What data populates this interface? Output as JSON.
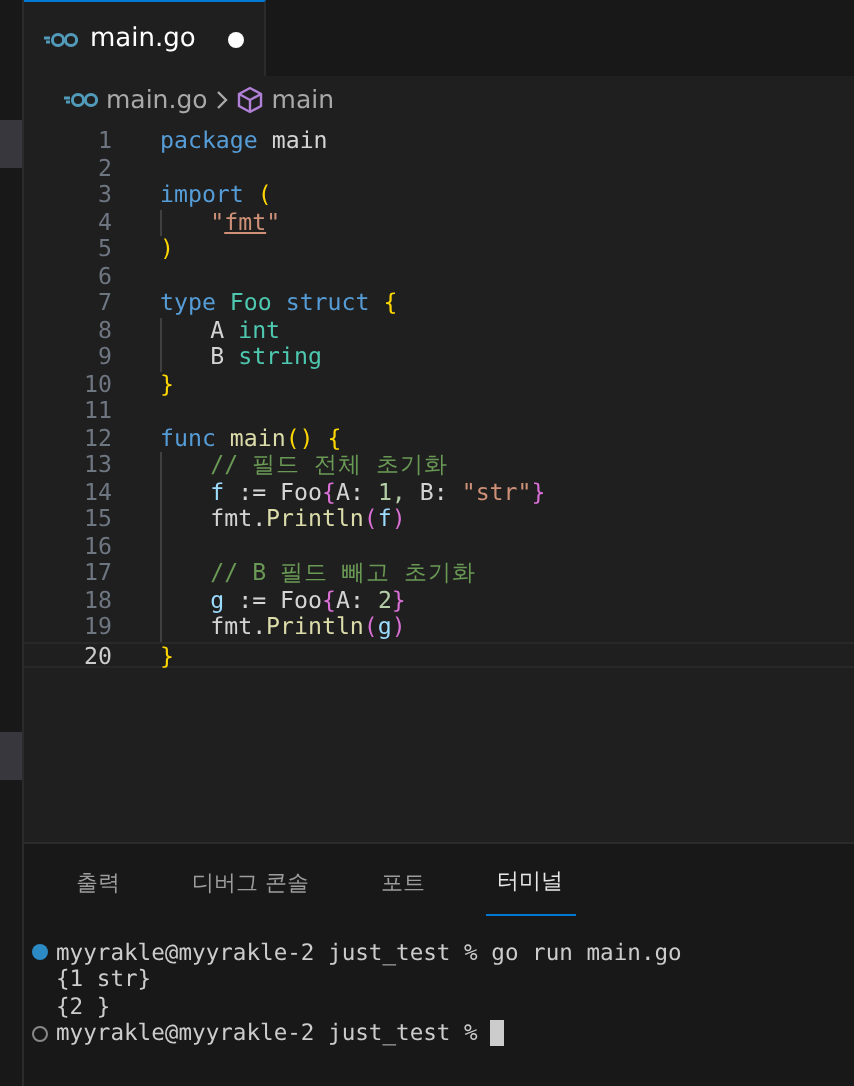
{
  "tab": {
    "label": "main.go",
    "modified": true,
    "selected": true
  },
  "breadcrumb": [
    "main.go",
    "main"
  ],
  "code": [
    {
      "number": "1",
      "current": false,
      "indented": false,
      "tokens": [
        {
          "text": "package",
          "kind": "kw"
        },
        {
          "text": "main",
          "kind": "plain"
        }
      ]
    },
    {
      "number": "2",
      "current": false,
      "indented": false
    },
    {
      "number": "3",
      "current": false,
      "indented": false,
      "tokens": [
        {
          "text": "import",
          "kind": "kw"
        },
        {
          "text": "(",
          "kind": "bracket1"
        }
      ]
    },
    {
      "number": "4",
      "current": false,
      "indented": true,
      "tokens": [
        {
          "text": "\"",
          "kind": "str"
        },
        {
          "text": "fmt",
          "kind": "strlink",
          "join": true
        },
        {
          "text": "\"",
          "kind": "str",
          "join": true
        }
      ]
    },
    {
      "number": "5",
      "current": false,
      "indented": false,
      "tokens": [
        {
          "text": ")",
          "kind": "bracket1"
        }
      ]
    },
    {
      "number": "6",
      "current": false,
      "indented": false
    },
    {
      "number": "7",
      "current": false,
      "indented": false,
      "tokens": [
        {
          "text": "type",
          "kind": "kw"
        },
        {
          "text": "Foo",
          "kind": "type"
        },
        {
          "text": "struct",
          "kind": "kw"
        },
        {
          "text": "{",
          "kind": "bracket1"
        }
      ]
    },
    {
      "number": "8",
      "current": false,
      "indented": true,
      "tokens": [
        {
          "text": "A",
          "kind": "plain"
        },
        {
          "text": "int",
          "kind": "type"
        }
      ]
    },
    {
      "number": "9",
      "current": false,
      "indented": true,
      "tokens": [
        {
          "text": "B",
          "kind": "plain"
        },
        {
          "text": "string",
          "kind": "type"
        }
      ]
    },
    {
      "number": "10",
      "current": false,
      "indented": false,
      "tokens": [
        {
          "text": "}",
          "kind": "bracket1"
        }
      ]
    },
    {
      "number": "11",
      "current": false,
      "indented": false
    },
    {
      "number": "12",
      "current": false,
      "indented": false,
      "tokens": [
        {
          "text": "func",
          "kind": "kw"
        },
        {
          "text": "main",
          "kind": "func"
        },
        {
          "text": "()",
          "kind": "bracket1",
          "join": true
        },
        {
          "text": "{",
          "kind": "bracket1"
        }
      ]
    },
    {
      "number": "13",
      "current": false,
      "indented": true,
      "tokens": [
        {
          "text": "// 필드 전체 초기화",
          "kind": "comment"
        }
      ]
    },
    {
      "number": "14",
      "current": false,
      "indented": true,
      "tokens": [
        {
          "text": "f",
          "kind": "var"
        },
        {
          "text": ":=",
          "kind": "plain"
        },
        {
          "text": "Foo",
          "kind": "plain"
        },
        {
          "text": "{",
          "kind": "bracket2",
          "join": true
        },
        {
          "text": "A:",
          "kind": "plain",
          "join": true
        },
        {
          "text": "1,",
          "kind": "num"
        },
        {
          "text": "B:",
          "kind": "plain"
        },
        {
          "text": "\"str\"",
          "kind": "str"
        },
        {
          "text": "}",
          "kind": "bracket2",
          "join": true
        }
      ]
    },
    {
      "number": "15",
      "current": false,
      "indented": true,
      "tokens": [
        {
          "text": "fmt.",
          "kind": "plain"
        },
        {
          "text": "Println",
          "kind": "func",
          "join": true
        },
        {
          "text": "(",
          "kind": "bracket2",
          "join": true
        },
        {
          "text": "f",
          "kind": "var",
          "join": true
        },
        {
          "text": ")",
          "kind": "bracket2",
          "join": true
        }
      ]
    },
    {
      "number": "16",
      "current": false,
      "indented": true
    },
    {
      "number": "17",
      "current": false,
      "indented": true,
      "tokens": [
        {
          "text": "// B 필드 빼고 초기화",
          "kind": "comment"
        }
      ]
    },
    {
      "number": "18",
      "current": false,
      "indented": true,
      "tokens": [
        {
          "text": "g",
          "kind": "var"
        },
        {
          "text": ":=",
          "kind": "plain"
        },
        {
          "text": "Foo",
          "kind": "plain"
        },
        {
          "text": "{",
          "kind": "bracket2",
          "join": true
        },
        {
          "text": "A:",
          "kind": "plain",
          "join": true
        },
        {
          "text": "2",
          "kind": "num"
        },
        {
          "text": "}",
          "kind": "bracket2",
          "join": true
        }
      ]
    },
    {
      "number": "19",
      "current": false,
      "indented": true,
      "tokens": [
        {
          "text": "fmt.",
          "kind": "plain"
        },
        {
          "text": "Println",
          "kind": "func",
          "join": true
        },
        {
          "text": "(",
          "kind": "bracket2",
          "join": true
        },
        {
          "text": "g",
          "kind": "var",
          "join": true
        },
        {
          "text": ")",
          "kind": "bracket2",
          "join": true
        }
      ]
    },
    {
      "number": "20",
      "current": true,
      "indented": false,
      "tokens": [
        {
          "text": "}",
          "kind": "bracket1"
        }
      ]
    }
  ],
  "panel_tabs": [
    {
      "label": "출력",
      "selected": false
    },
    {
      "label": "디버그 콘솔",
      "selected": false
    },
    {
      "label": "포트",
      "selected": false
    },
    {
      "label": "터미널",
      "selected": true
    }
  ],
  "terminal": [
    {
      "kind": "success",
      "text": "myyrakle@myyrakle-2 just_test % go run main.go",
      "cursor": false
    },
    {
      "kind": "output",
      "text": "{1 str}",
      "cursor": false
    },
    {
      "kind": "output",
      "text": "{2 }",
      "cursor": false
    },
    {
      "kind": "idle",
      "text": "myyrakle@myyrakle-2 just_test %",
      "cursor": true
    }
  ]
}
